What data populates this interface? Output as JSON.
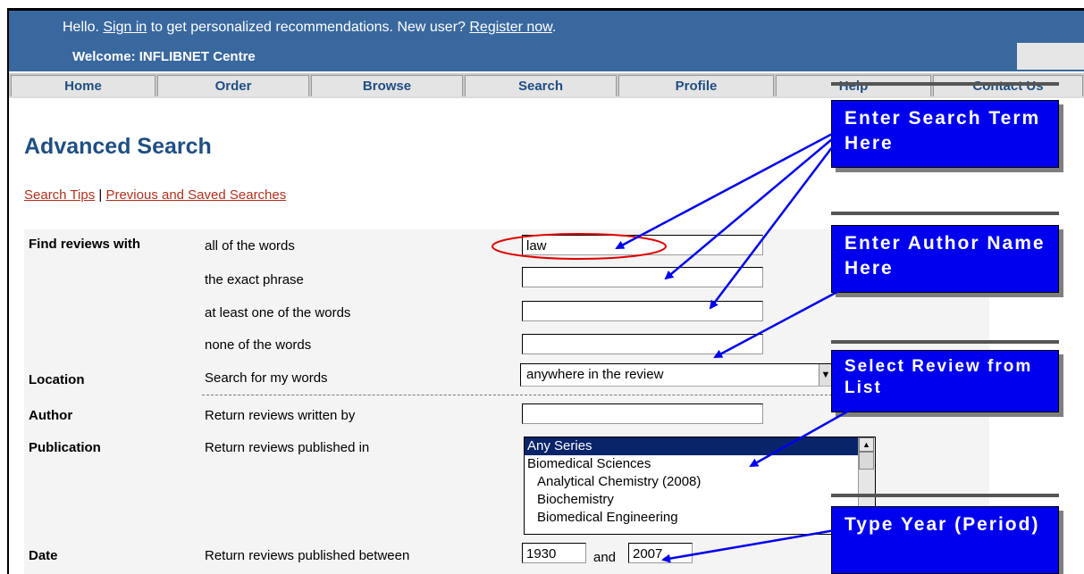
{
  "header": {
    "hello_prefix": "Hello. ",
    "sign_in": "Sign in",
    "hello_middle": " to get personalized recommendations. New user? ",
    "register": "Register now",
    "hello_suffix": ".",
    "welcome": "Welcome: INFLIBNET Centre"
  },
  "nav": {
    "tabs": [
      "Home",
      "Order",
      "Browse",
      "Search",
      "Profile",
      "Help",
      "Contact Us"
    ]
  },
  "page": {
    "title": "Advanced Search",
    "search_tips": "Search Tips",
    "links_separator": " | ",
    "saved_searches": "Previous and Saved Searches"
  },
  "form": {
    "find_label": "Find reviews with",
    "all_words_label": "all of the words",
    "all_words_value": "law",
    "exact_phrase_label": "the exact phrase",
    "one_of_label": "at least one of the words",
    "none_label": "none of the words",
    "location_label": "Location",
    "location_text": "Search for my words",
    "location_value": "anywhere in the review",
    "author_label": "Author",
    "author_text": "Return reviews written by",
    "publication_label": "Publication",
    "publication_text": "Return reviews published in",
    "publication_options": [
      "Any Series",
      "Biomedical Sciences",
      "   Analytical Chemistry (2008)",
      "   Biochemistry",
      "   Biomedical Engineering"
    ],
    "date_label": "Date",
    "date_text": "Return reviews published between",
    "date_from": "1930",
    "date_and": "and",
    "date_to": "2007"
  },
  "callouts": {
    "search_term": "Enter Search Term Here",
    "author_name": "Enter Author Name Here",
    "select_review": "Select Review from List",
    "type_year": "Type Year (Period)"
  },
  "colors": {
    "header_bg": "#39689e",
    "title_blue": "#1f4e83",
    "link_red": "#b0321e",
    "callout_blue": "#0000ee",
    "highlight_circle": "#e00000"
  }
}
